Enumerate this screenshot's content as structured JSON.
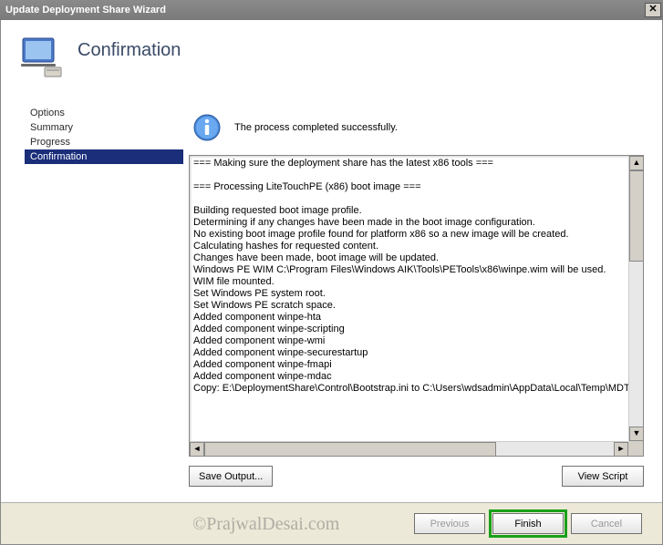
{
  "window": {
    "title": "Update Deployment Share Wizard"
  },
  "header": {
    "title": "Confirmation"
  },
  "sidebar": {
    "items": [
      {
        "label": "Options"
      },
      {
        "label": "Summary"
      },
      {
        "label": "Progress"
      },
      {
        "label": "Confirmation",
        "selected": true
      }
    ]
  },
  "status": {
    "message": "The process completed successfully."
  },
  "log": {
    "text": "=== Making sure the deployment share has the latest x86 tools ===\n\n=== Processing LiteTouchPE (x86) boot image ===\n\nBuilding requested boot image profile.\nDetermining if any changes have been made in the boot image configuration.\nNo existing boot image profile found for platform x86 so a new image will be created.\nCalculating hashes for requested content.\nChanges have been made, boot image will be updated.\nWindows PE WIM C:\\Program Files\\Windows AIK\\Tools\\PETools\\x86\\winpe.wim will be used.\nWIM file mounted.\nSet Windows PE system root.\nSet Windows PE scratch space.\nAdded component winpe-hta\nAdded component winpe-scripting\nAdded component winpe-wmi\nAdded component winpe-securestartup\nAdded component winpe-fmapi\nAdded component winpe-mdac\nCopy: E:\\DeploymentShare\\Control\\Bootstrap.ini to C:\\Users\\wdsadmin\\AppData\\Local\\Temp\\MDT"
  },
  "buttons": {
    "save_output": "Save Output...",
    "view_script": "View Script",
    "previous": "Previous",
    "finish": "Finish",
    "cancel": "Cancel"
  },
  "watermark": "©PrajwalDesai.com"
}
